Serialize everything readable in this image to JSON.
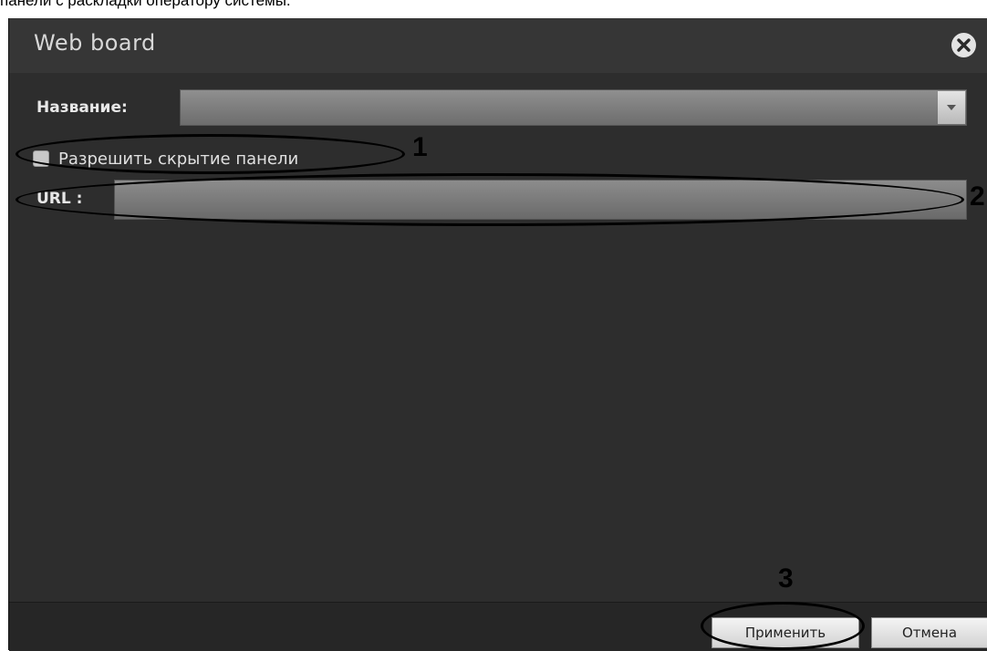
{
  "caption": "панели с раскладки оператору системы.",
  "dialog": {
    "title": "Web board",
    "name_label": "Название:",
    "name_value": "",
    "allow_hide_label": "Разрешить скрытие панели",
    "url_label": "URL :",
    "url_value": "",
    "apply_label": "Применить",
    "cancel_label": "Отмена"
  },
  "annotations": {
    "one": "1",
    "two": "2",
    "three": "3"
  },
  "icons": {
    "close": "close-icon",
    "dropdown": "chevron-down-icon"
  }
}
